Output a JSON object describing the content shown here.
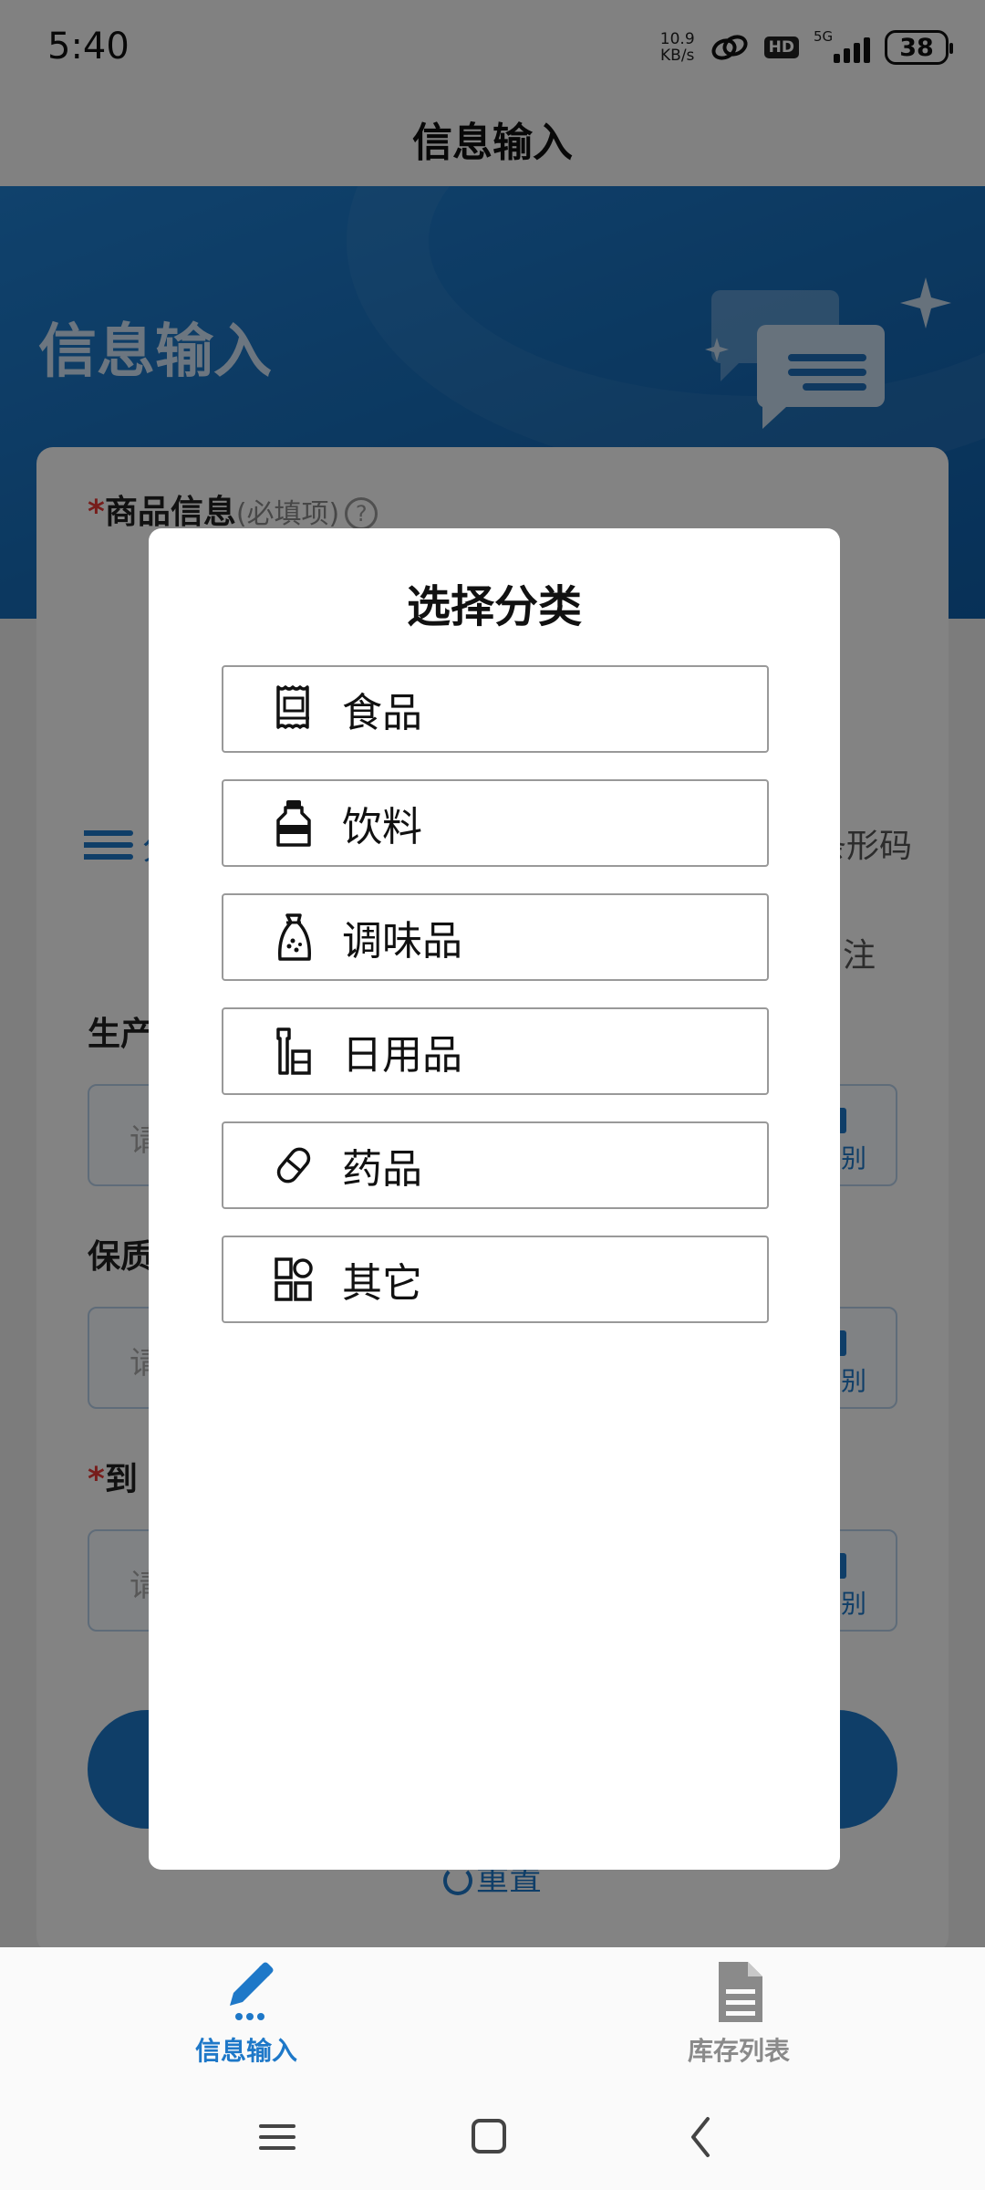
{
  "status_bar": {
    "time": "5:40",
    "net_speed_value": "10.9",
    "net_speed_unit": "KB/s",
    "hd": "HD",
    "network": "5G",
    "battery": "38"
  },
  "header": {
    "title": "信息输入"
  },
  "hero": {
    "title": "信息输入"
  },
  "form": {
    "product_info_label": "商品信息",
    "product_info_hint": "(必填项)",
    "required_mark": "*",
    "help_glyph": "?",
    "category_partial": "分",
    "barcode_partial": "条形码",
    "note_partial": "注",
    "production_date_partial": "生产",
    "shelf_life_partial": "保质",
    "arrival_partial": "到",
    "input_placeholder_partial": "请",
    "scan_label_partial": "识别",
    "reset_label": "重置"
  },
  "modal": {
    "title": "选择分类",
    "items": [
      {
        "label": "食品",
        "icon": "food-package-icon"
      },
      {
        "label": "饮料",
        "icon": "drink-bottle-icon"
      },
      {
        "label": "调味品",
        "icon": "seasoning-bag-icon"
      },
      {
        "label": "日用品",
        "icon": "daily-goods-icon"
      },
      {
        "label": "药品",
        "icon": "pill-capsule-icon"
      },
      {
        "label": "其它",
        "icon": "grid-apps-icon"
      }
    ]
  },
  "bottom_nav": {
    "items": [
      {
        "label": "信息输入",
        "icon": "pencil-icon",
        "active": true
      },
      {
        "label": "库存列表",
        "icon": "document-list-icon",
        "active": false
      }
    ]
  },
  "colors": {
    "accent": "#1e78c8",
    "inactive": "#8a8a8a",
    "required": "#e53935"
  }
}
